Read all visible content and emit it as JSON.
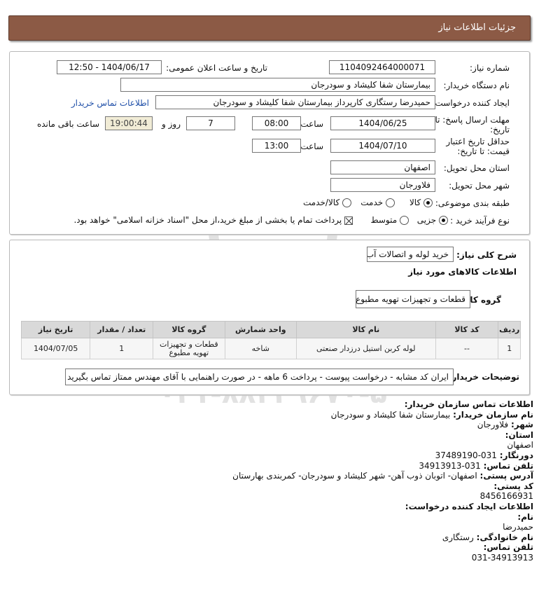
{
  "header": {
    "title": "جزئیات اطلاعات نیاز"
  },
  "form": {
    "need_number_label": "شماره نیاز:",
    "need_number": "1104092464000071",
    "announce_label": "تاریخ و ساعت اعلان عمومی:",
    "announce_value": "1404/06/17 - 12:50",
    "buyer_org_label": "نام دستگاه خریدار:",
    "buyer_org": "بیمارستان شفا کلیشاد و سودرجان",
    "requester_label": "ایجاد کننده درخواست:",
    "requester": "حمیدرضا رستگاری کارپرداز بیمارستان شفا کلیشاد و سودرجان",
    "contact_link": "اطلاعات تماس خریدار",
    "deadline_label_1": "مهلت ارسال پاسخ: تا",
    "deadline_label_2": "تاریخ:",
    "deadline_date": "1404/06/25",
    "time_label": "ساعت",
    "deadline_time": "08:00",
    "days_value": "7",
    "days_label": "روز و",
    "remaining_time": "19:00:44",
    "remaining_label": "ساعت باقی مانده",
    "validity_label_1": "حداقل تاریخ اعتبار",
    "validity_label_2": "قیمت: تا تاریخ:",
    "validity_date": "1404/07/10",
    "validity_time": "13:00",
    "province_label": "استان محل تحویل:",
    "province": "اصفهان",
    "city_label": "شهر محل تحویل:",
    "city": "فلاورجان",
    "category_label": "طبقه بندی موضوعی:",
    "category_options": [
      "کالا",
      "خدمت",
      "کالا/خدمت"
    ],
    "purchase_type_label": "نوع فرآیند خرید :",
    "purchase_options": [
      "جزیی",
      "متوسط"
    ],
    "payment_note": "پرداخت تمام یا بخشی از مبلغ خرید،از محل \"اسناد خزانه اسلامی\" خواهد بود."
  },
  "details": {
    "summary_label": "شرح کلی نیاز:",
    "summary": "خرید لوله و اتصالات آب",
    "goods_info_label": "اطلاعات کالاهای مورد نیاز",
    "goods_group_label": "گروه کالا:",
    "goods_group": "قطعات و تجهیزات تهویه مطبوع",
    "table_headers": [
      "ردیف",
      "کد کالا",
      "نام کالا",
      "واحد شمارش",
      "گروه کالا",
      "تعداد / مقدار",
      "تاریخ نیاز"
    ],
    "rows": [
      {
        "row": "1",
        "code": "--",
        "name": "لوله کربن استیل درزدار صنعتی",
        "unit": "شاخه",
        "group": "قطعات و تجهیزات تهویه مطبوع",
        "qty": "1",
        "date": "1404/07/05"
      }
    ],
    "buyer_notes_label": "توضیحات خریدار:",
    "buyer_notes": "ایران کد مشابه - درخواست پیوست - پرداخت 6 ماهه - در صورت راهنمایی با آقای مهندس ممتاز تماس بگیرید"
  },
  "contact": {
    "title": "اطلاعات تماس سازمان خریدار:",
    "org_name_label": "نام سازمان خریدار:",
    "org_name": "بیمارستان شفا کلیشاد و سودرجان",
    "city_label": "شهر:",
    "city": "فلاورجان",
    "province_label": "استان:",
    "province": "اصفهان",
    "fax_label": "دورنگار:",
    "fax": "031-37489190",
    "phone_label": "تلفن تماس:",
    "phone": "031-34913913",
    "address_label": "آدرس پستی:",
    "address": "اصفهان- اتوبان ذوب آهن- شهر کلیشاد و سودرجان- کمربندی بهارستان",
    "postal_label": "کد پستی:",
    "postal": "8456166931",
    "creator_title": "اطلاعات ایجاد کننده درخواست:",
    "first_name_label": "نام:",
    "first_name": "حمیدرضا",
    "last_name_label": "نام خانوادگی:",
    "last_name": "رستگاری",
    "creator_phone_label": "تلفن تماس:",
    "creator_phone": "031-34913913"
  },
  "watermark": {
    "line1": "ParsNamadData",
    "line2": "۰۲۱-۸۸۳۴۹۶۷۰-۵"
  },
  "colors": {
    "header_bg": "#8c5a45",
    "link": "#1f4fa8",
    "table_header": "#d9d9d9",
    "time_box": "#f1ecd6"
  }
}
